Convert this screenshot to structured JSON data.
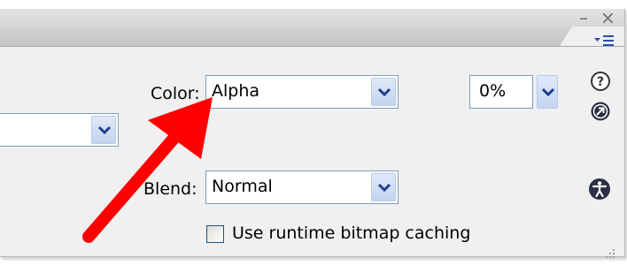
{
  "window": {
    "minimize_glyph": "–",
    "close_glyph": "×"
  },
  "icons": {
    "panel_menu": "panel-menu-icon",
    "help": "help-icon",
    "action": "action-arrow-icon",
    "accessibility": "accessibility-icon",
    "resize": "resize-grip-icon"
  },
  "filters": {
    "left_dropdown_value": ""
  },
  "color": {
    "label": "Color:",
    "value": "Alpha",
    "amount": "0%"
  },
  "blend": {
    "label": "Blend:",
    "value": "Normal"
  },
  "cache": {
    "label": "Use runtime bitmap caching",
    "checked": false
  },
  "colors": {
    "panel_bg": "#f0f0f0",
    "field_border": "#7f9db9",
    "dropdown_button": "#c3d4f0",
    "chevron": "#1f3f8c",
    "annotation_arrow": "#ff0000"
  }
}
